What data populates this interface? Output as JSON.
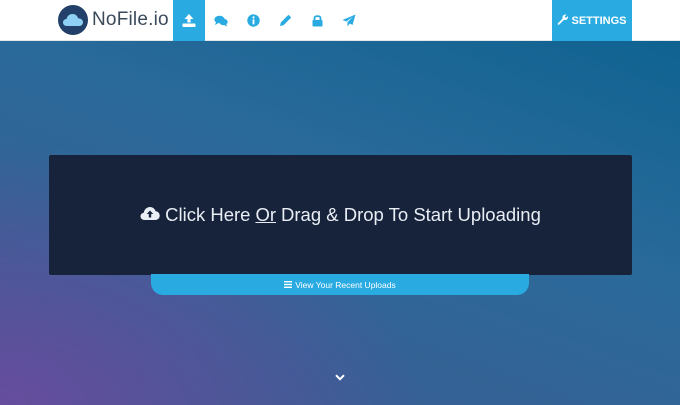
{
  "brand": {
    "name": "NoFile.io",
    "logo_icon": "cloud-logo-icon"
  },
  "nav": {
    "items": [
      {
        "icon": "upload-icon",
        "active": true
      },
      {
        "icon": "comments-icon",
        "active": false
      },
      {
        "icon": "info-icon",
        "active": false
      },
      {
        "icon": "pencil-icon",
        "active": false
      },
      {
        "icon": "lock-icon",
        "active": false
      },
      {
        "icon": "paper-plane-icon",
        "active": false
      }
    ],
    "settings_label": "SETTINGS",
    "settings_icon": "wrench-icon"
  },
  "upload": {
    "prefix": "Click Here",
    "or": "Or",
    "suffix": "Drag & Drop To Start Uploading",
    "icon": "cloud-upload-icon"
  },
  "recent": {
    "label": "View Your Recent Uploads",
    "icon": "bars-icon"
  },
  "scroll": {
    "icon": "chevron-down-icon"
  },
  "colors": {
    "accent": "#29abe2",
    "box": "#17233a",
    "nav_bg": "#ffffff"
  }
}
